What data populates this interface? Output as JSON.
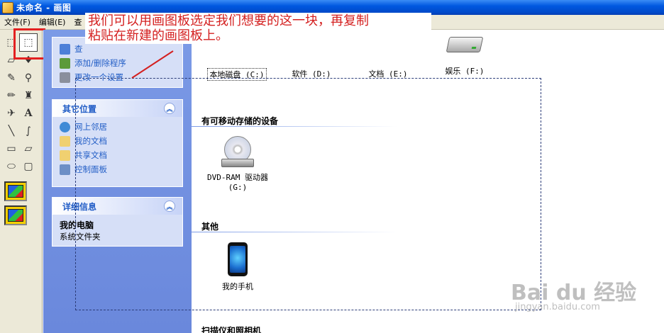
{
  "window": {
    "title": "未命名 - 画图"
  },
  "menu": [
    "文件(F)",
    "编辑(E)",
    "查"
  ],
  "annotation": {
    "line1": "我们可以用画图板选定我们想要的这一块，再复制",
    "line2": "粘贴在新建的画图板上。"
  },
  "tasks": {
    "items": [
      "查",
      "添加/删除程序",
      "更改一个设置"
    ]
  },
  "other_places": {
    "header": "其它位置",
    "items": [
      "网上邻居",
      "我的文档",
      "共享文档",
      "控制面板"
    ]
  },
  "details": {
    "header": "详细信息",
    "title": "我的电脑",
    "subtitle": "系统文件夹"
  },
  "drives": [
    {
      "label": "本地磁盘 (C:)"
    },
    {
      "label": "软件 (D:)"
    },
    {
      "label": "文档 (E:)"
    },
    {
      "label": "娱乐 (F:)"
    }
  ],
  "removable": {
    "header": "有可移动存储的设备",
    "device_line1": "DVD-RAM 驱动器",
    "device_line2": "(G:)"
  },
  "other": {
    "header": "其他",
    "device": "我的手机"
  },
  "scanners": {
    "header": "扫描仪和照相机"
  },
  "watermark": {
    "brand": "Bai du 经验",
    "url": "jingyan.baidu.com"
  }
}
